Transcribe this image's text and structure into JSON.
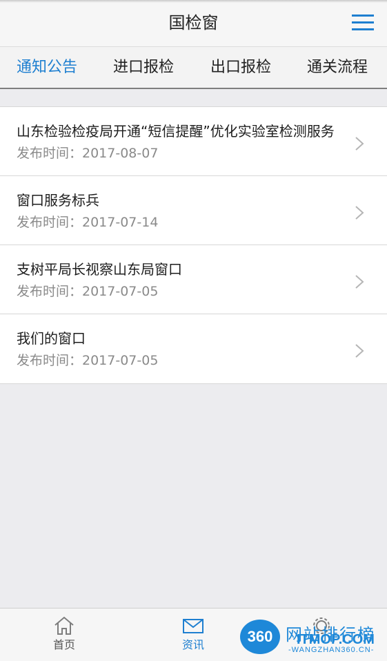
{
  "header": {
    "title": "国检窗",
    "menu_icon": "hamburger-menu-icon"
  },
  "tabs": [
    {
      "label": "通知公告",
      "active": true
    },
    {
      "label": "进口报检",
      "active": false
    },
    {
      "label": "出口报检",
      "active": false
    },
    {
      "label": "通关流程",
      "active": false
    }
  ],
  "notices": [
    {
      "title": "山东检验检疫局开通“短信提醒”优化实验室检测服务",
      "date": "发布时间：2017-08-07"
    },
    {
      "title": "窗口服务标兵",
      "date": "发布时间：2017-07-14"
    },
    {
      "title": "支树平局长视察山东局窗口",
      "date": "发布时间：2017-07-05"
    },
    {
      "title": "我们的窗口",
      "date": "发布时间：2017-07-05"
    }
  ],
  "bottom_nav": [
    {
      "label": "首页",
      "icon": "home-icon",
      "active": false
    },
    {
      "label": "资讯",
      "icon": "mail-icon",
      "active": true
    },
    {
      "label": "",
      "icon": "gear-icon",
      "active": false
    }
  ],
  "watermark": {
    "badge": "360",
    "title": "网站排行榜",
    "brand": "ITMOP.COM",
    "subtitle": "-WANGZHAN360.CN-"
  },
  "colors": {
    "accent": "#1e7fd0",
    "background": "#ececef"
  }
}
